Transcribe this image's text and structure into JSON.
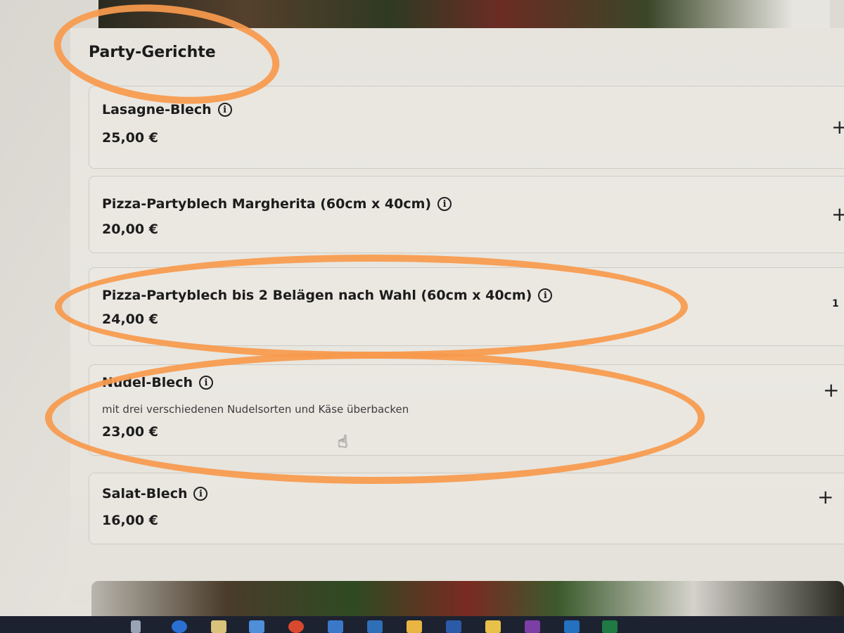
{
  "category": {
    "title": "Party-Gerichte"
  },
  "items": [
    {
      "name": "Lasagne-Blech",
      "price": "25,00 €",
      "action": "+"
    },
    {
      "name": "Pizza-Partyblech Margherita (60cm x 40cm)",
      "price": "20,00 €",
      "action": "+"
    },
    {
      "name": "Pizza-Partyblech bis 2 Belägen nach Wahl (60cm x 40cm)",
      "price": "24,00 €",
      "quantity": "1"
    },
    {
      "name": "Nudel-Blech",
      "description": "mit drei verschiedenen Nudelsorten und Käse überbacken",
      "price": "23,00 €",
      "action": "+"
    },
    {
      "name": "Salat-Blech",
      "price": "16,00 €",
      "action": "+"
    }
  ],
  "icons": {
    "info": "i",
    "add": "+"
  },
  "colors": {
    "highlight": "#f79a4e",
    "text": "#1c1c1c"
  }
}
